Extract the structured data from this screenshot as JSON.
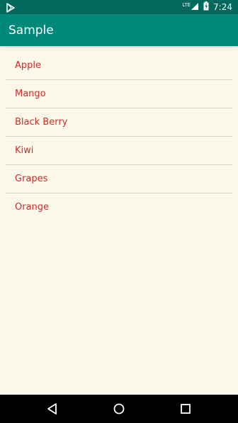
{
  "status_bar": {
    "network": "LTE",
    "time": "7:24",
    "icons": [
      "play-store-icon",
      "signal-icon",
      "battery-charging-icon"
    ]
  },
  "app_bar": {
    "title": "Sample"
  },
  "list": {
    "items": [
      {
        "label": "Apple"
      },
      {
        "label": "Mango"
      },
      {
        "label": "Black Berry"
      },
      {
        "label": "Kiwi"
      },
      {
        "label": "Grapes"
      },
      {
        "label": "Orange"
      }
    ]
  },
  "nav_bar": {
    "buttons": [
      "back-icon",
      "home-icon",
      "recents-icon"
    ]
  },
  "colors": {
    "status_bar": "#00695c",
    "app_bar": "#00897b",
    "background": "#fbf8ea",
    "item_text": "#d12b2b",
    "divider": "#d7d4c9",
    "nav_bar": "#000000"
  }
}
